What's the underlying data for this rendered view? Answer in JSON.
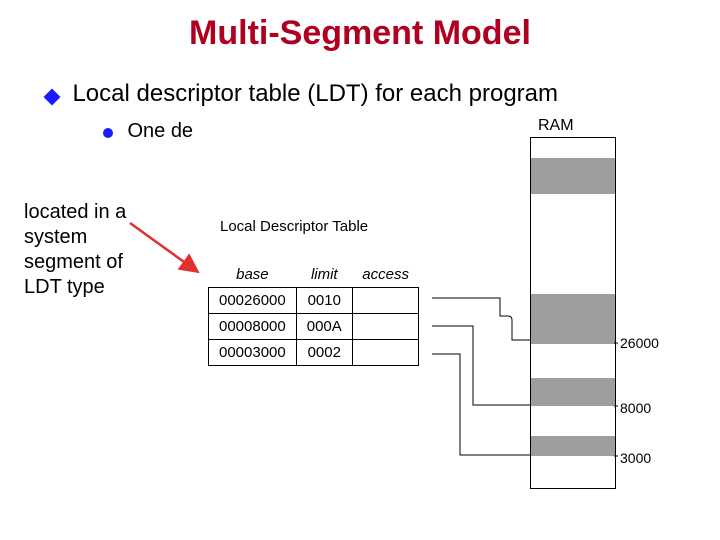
{
  "title": "Multi-Segment Model",
  "bullet_main": "Local descriptor table (LDT) for each program",
  "bullet_sub": "One de",
  "annotation": "located in a\nsystem\nsegment of\nLDT type",
  "ram_label": "RAM",
  "ram_ticks": {
    "t1": "26000",
    "t2": "8000",
    "t3": "3000"
  },
  "table": {
    "caption": "Local Descriptor Table",
    "headers": {
      "base": "base",
      "limit": "limit",
      "access": "access"
    },
    "rows": [
      {
        "base": "00026000",
        "limit": "0010",
        "access": ""
      },
      {
        "base": "00008000",
        "limit": "000A",
        "access": ""
      },
      {
        "base": "00003000",
        "limit": "0002",
        "access": ""
      }
    ]
  },
  "chart_data": {
    "type": "table",
    "title": "Local Descriptor Table mapping to RAM",
    "columns": [
      "base",
      "limit"
    ],
    "rows": [
      [
        "00026000",
        "0010"
      ],
      [
        "00008000",
        "000A"
      ],
      [
        "00003000",
        "0002"
      ]
    ],
    "ram_segments_top_to_bottom": [
      {
        "label": "",
        "shaded": true
      },
      {
        "label": "26000",
        "shaded": true
      },
      {
        "label": "8000",
        "shaded": true
      },
      {
        "label": "3000",
        "shaded": true
      }
    ]
  }
}
